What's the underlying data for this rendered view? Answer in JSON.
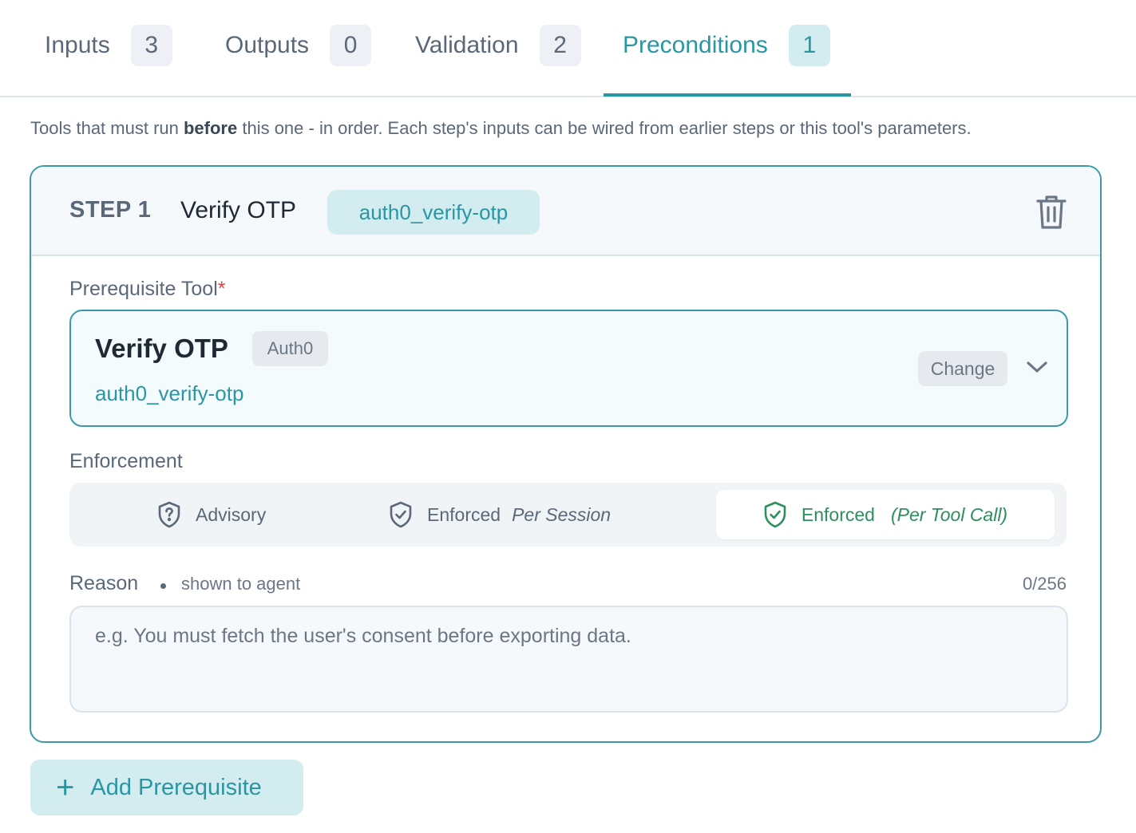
{
  "tabs": [
    {
      "label": "Inputs",
      "count": "3"
    },
    {
      "label": "Outputs",
      "count": "0"
    },
    {
      "label": "Validation",
      "count": "2"
    },
    {
      "label": "Preconditions",
      "count": "1"
    }
  ],
  "active_tab": "Preconditions",
  "description": {
    "pre": "Tools that must run ",
    "bold": "before",
    "post": " this one - in order. Each step's inputs can be wired from earlier steps or this tool's parameters."
  },
  "step": {
    "label": "STEP 1",
    "name": "Verify OTP",
    "slug": "auth0_verify-otp",
    "delete_icon": "trash-icon"
  },
  "prerequisite": {
    "label": "Prerequisite Tool",
    "required_mark": "*",
    "tool_name": "Verify OTP",
    "provider": "Auth0",
    "tool_slug": "auth0_verify-otp",
    "change_label": "Change",
    "expand_icon": "chevron-down-icon"
  },
  "enforcement": {
    "label": "Enforcement",
    "options": [
      {
        "label": "Advisory",
        "sub": "",
        "icon": "shield-question-icon"
      },
      {
        "label": "Enforced",
        "sub": "Per Session",
        "icon": "shield-check-icon"
      },
      {
        "label": "Enforced",
        "sub": "(Per Tool Call)",
        "icon": "shield-check-icon"
      }
    ],
    "selected_index": 2
  },
  "reason": {
    "label": "Reason",
    "hint": "shown to agent",
    "counter": "0/256",
    "value": "",
    "placeholder": "e.g. You must fetch the user's consent before exporting data."
  },
  "add_button": {
    "label": "Add Prerequisite",
    "icon": "plus-icon"
  },
  "colors": {
    "accent": "#2b96a3",
    "accent_bg": "#d3ecef",
    "success": "#2d8f5e",
    "required": "#d64545"
  }
}
